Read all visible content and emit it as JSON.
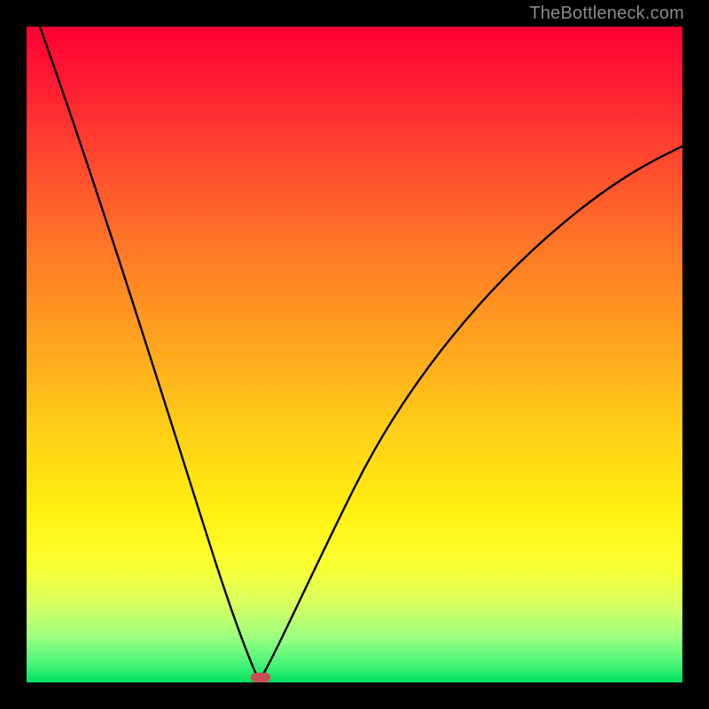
{
  "watermark": "TheBottleneck.com",
  "chart_data": {
    "type": "line",
    "title": "",
    "xlabel": "",
    "ylabel": "",
    "xlim": [
      0,
      100
    ],
    "ylim": [
      0,
      100
    ],
    "background_gradient": {
      "top": "#ff0033",
      "bottom": "#00e060",
      "stops": [
        "red",
        "orange",
        "yellow",
        "green"
      ]
    },
    "series": [
      {
        "name": "left-branch",
        "x": [
          2,
          10,
          18,
          24,
          28,
          31,
          33,
          34.5,
          35.5
        ],
        "values": [
          100,
          76,
          52,
          34,
          20,
          10,
          4,
          1,
          0
        ]
      },
      {
        "name": "right-branch",
        "x": [
          35.5,
          37,
          40,
          45,
          52,
          60,
          70,
          82,
          92,
          100
        ],
        "values": [
          0,
          2,
          8,
          20,
          35,
          48,
          60,
          70,
          77,
          82
        ]
      }
    ],
    "marker": {
      "name": "bottleneck-point",
      "x": 35.5,
      "y": 0,
      "color": "#c94f57",
      "shape": "pill"
    }
  }
}
